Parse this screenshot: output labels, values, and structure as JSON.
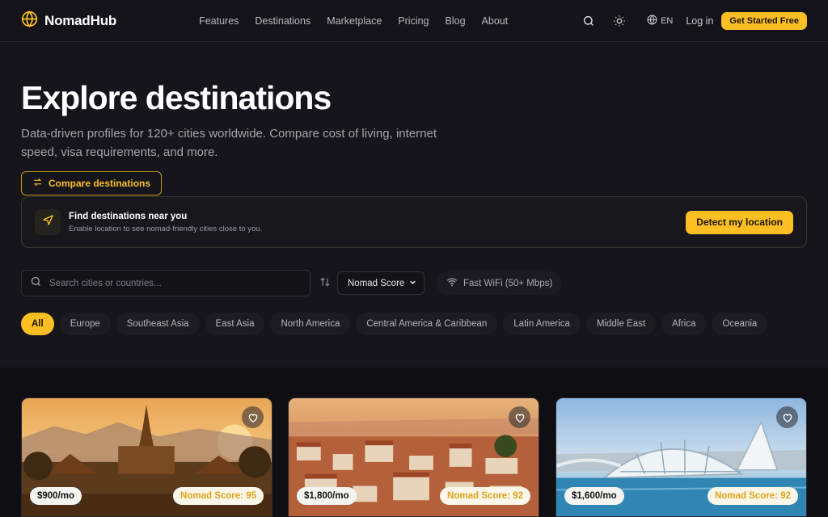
{
  "nav": {
    "brand": "NomadHub",
    "links": [
      "Features",
      "Destinations",
      "Marketplace",
      "Pricing",
      "Blog",
      "About"
    ],
    "lang": "EN",
    "login": "Log in",
    "cta": "Get Started Free"
  },
  "hero": {
    "title": "Explore destinations",
    "subtitle": "Data-driven profiles for 120+ cities worldwide. Compare cost of living, internet speed, visa requirements, and more.",
    "compare_label": "Compare destinations"
  },
  "location": {
    "title": "Find destinations near you",
    "description": "Enable location to see nomad-friendly cities close to you.",
    "button": "Detect my location"
  },
  "filters": {
    "search_placeholder": "Search cities or countries...",
    "sort_value": "Nomad Score",
    "wifi_label": "Fast WiFi (50+ Mbps)",
    "regions": [
      "All",
      "Europe",
      "Southeast Asia",
      "East Asia",
      "North America",
      "Central America & Caribbean",
      "Latin America",
      "Middle East",
      "Africa",
      "Oceania"
    ],
    "active_region": "All"
  },
  "cards": [
    {
      "price": "$900/mo",
      "score": "Nomad Score: 95"
    },
    {
      "price": "$1,800/mo",
      "score": "Nomad Score: 92"
    },
    {
      "price": "$1,600/mo",
      "score": "Nomad Score: 92"
    }
  ],
  "colors": {
    "accent": "#fbbf24",
    "background": "#15151b"
  }
}
